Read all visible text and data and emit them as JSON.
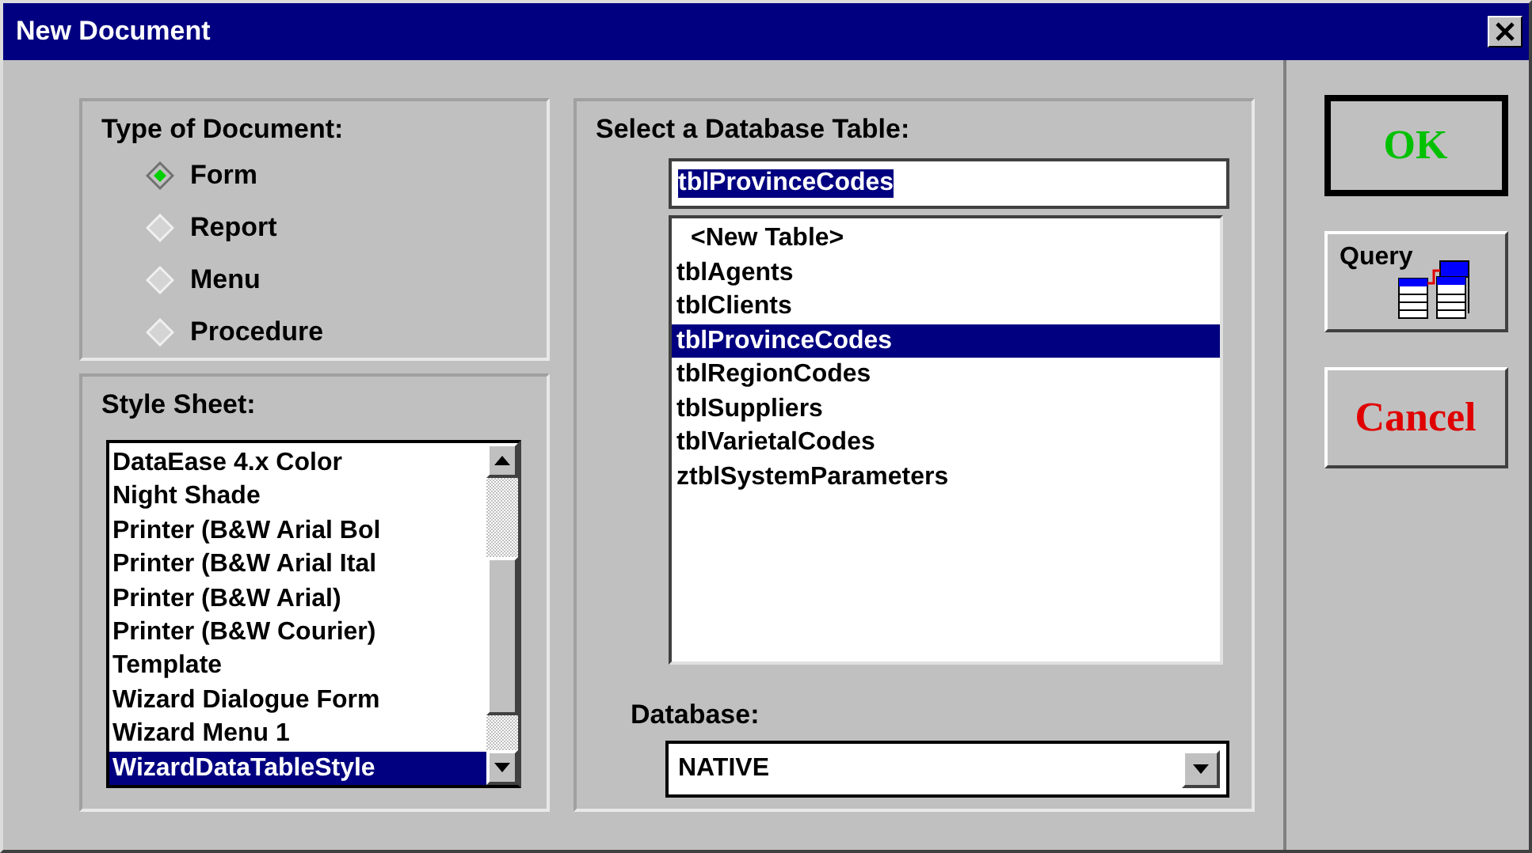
{
  "window": {
    "title": "New Document"
  },
  "document_type": {
    "label": "Type of Document:",
    "options": [
      {
        "label": "Form",
        "selected": true
      },
      {
        "label": "Report",
        "selected": false
      },
      {
        "label": "Menu",
        "selected": false
      },
      {
        "label": "Procedure",
        "selected": false
      }
    ]
  },
  "style_sheet": {
    "label": "Style Sheet:",
    "items": [
      {
        "text": "DataEase 4.x Color",
        "selected": false
      },
      {
        "text": "Night Shade",
        "selected": false
      },
      {
        "text": "Printer (B&W Arial Bol",
        "selected": false
      },
      {
        "text": "Printer (B&W Arial Ital",
        "selected": false
      },
      {
        "text": "Printer (B&W Arial)",
        "selected": false
      },
      {
        "text": "Printer (B&W Courier)",
        "selected": false
      },
      {
        "text": "Template",
        "selected": false
      },
      {
        "text": "Wizard Dialogue Form",
        "selected": false
      },
      {
        "text": "Wizard Menu 1",
        "selected": false
      },
      {
        "text": "WizardDataTableStyle",
        "selected": true
      }
    ]
  },
  "table_select": {
    "label": "Select a Database Table:",
    "value": "tblProvinceCodes",
    "items": [
      {
        "text": "<New Table>",
        "selected": false
      },
      {
        "text": "tblAgents",
        "selected": false
      },
      {
        "text": "tblClients",
        "selected": false
      },
      {
        "text": "tblProvinceCodes",
        "selected": true
      },
      {
        "text": "tblRegionCodes",
        "selected": false
      },
      {
        "text": "tblSuppliers",
        "selected": false
      },
      {
        "text": "tblVarietalCodes",
        "selected": false
      },
      {
        "text": "ztblSystemParameters",
        "selected": false
      }
    ]
  },
  "database": {
    "label": "Database:",
    "value": "NATIVE"
  },
  "buttons": [
    {
      "kind": "ok",
      "label": "OK"
    },
    {
      "kind": "query",
      "label": "Query"
    },
    {
      "kind": "cancel",
      "label": "Cancel"
    }
  ]
}
